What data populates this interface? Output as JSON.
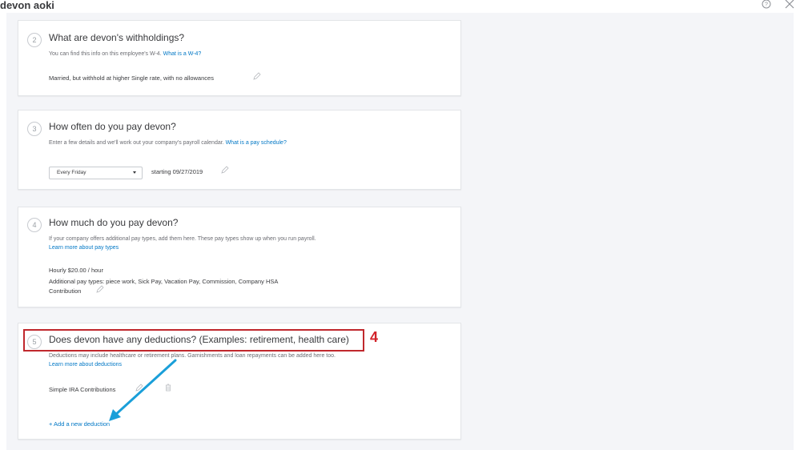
{
  "header": {
    "title": "devon aoki"
  },
  "sections": {
    "withholdings": {
      "step": "2",
      "heading": "What are devon's withholdings?",
      "desc": "You can find this info on this employee's W-4.",
      "link": "What is a W-4?",
      "value": "Married, but withhold at higher Single rate, with no allowances"
    },
    "pay_schedule": {
      "step": "3",
      "heading": "How often do you pay devon?",
      "desc": "Enter a few details and we'll work out your company's payroll calendar.",
      "link": "What is a pay schedule?",
      "select_value": "Every Friday",
      "starting": "starting 09/27/2019"
    },
    "pay": {
      "step": "4",
      "heading": "How much do you pay devon?",
      "desc": "If your company offers additional pay types, add them here. These pay types show up when you run payroll.",
      "link": "Learn more about pay types",
      "rate": "Hourly $20.00 / hour",
      "additional_line1": "Additional pay types: piece work, Sick Pay, Vacation Pay, Commission, Company HSA",
      "additional_line2": "Contribution"
    },
    "deductions": {
      "step": "5",
      "heading": "Does devon have any deductions? (Examples: retirement, health care)",
      "desc": "Deductions may include healthcare or retirement plans. Garnishments and loan repayments can be added here too.",
      "link": "Learn more about deductions",
      "item": "Simple IRA Contributions",
      "add_link": "+ Add a new deduction"
    }
  },
  "annotation": {
    "number": "4",
    "box_color": "#c0282d",
    "arrow_color": "#1a9fd9"
  },
  "icons": [
    "help-icon",
    "close-icon",
    "pencil-icon",
    "trash-icon",
    "chevron-down-icon"
  ]
}
